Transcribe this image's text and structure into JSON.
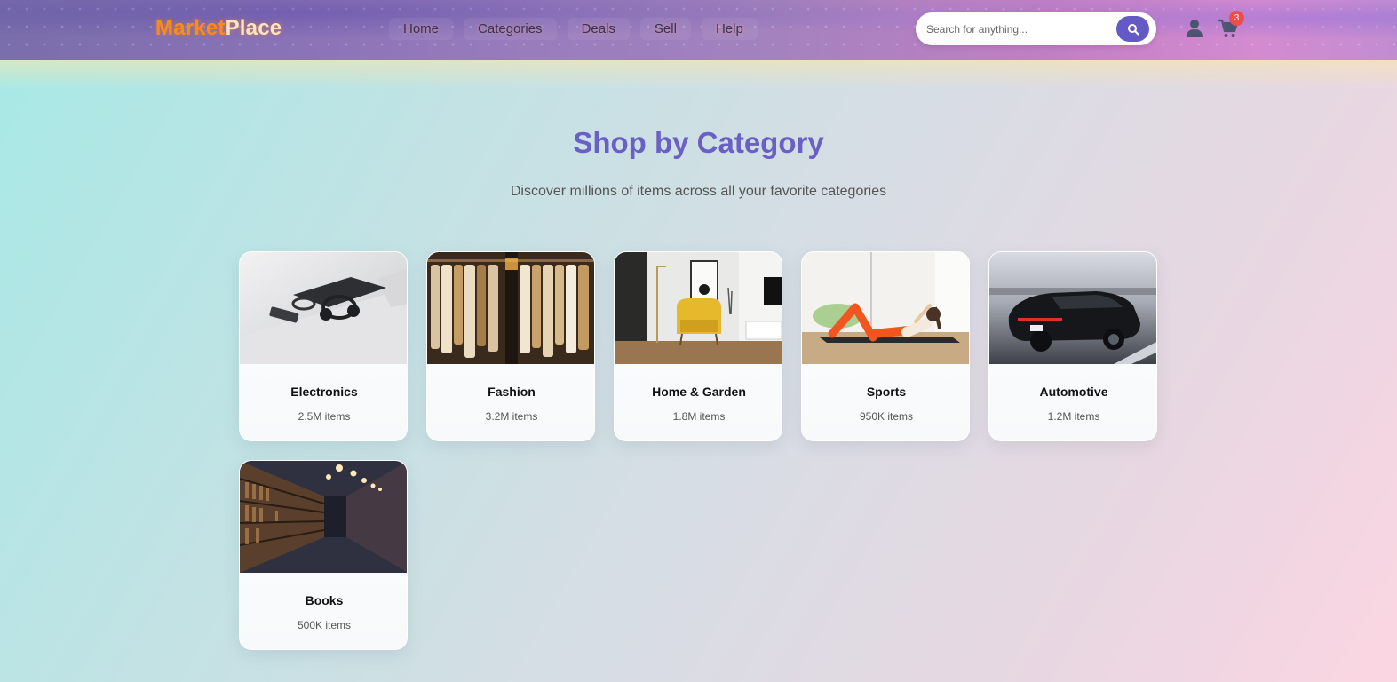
{
  "brand": {
    "part1": "Market",
    "part2": "Place"
  },
  "nav": {
    "items": [
      {
        "label": "Home"
      },
      {
        "label": "Categories"
      },
      {
        "label": "Deals"
      },
      {
        "label": "Sell"
      },
      {
        "label": "Help"
      }
    ]
  },
  "search": {
    "placeholder": "Search for anything...",
    "value": ""
  },
  "header_icons": {
    "user": "user-icon",
    "cart": "cart-icon",
    "search": "search-icon"
  },
  "cart": {
    "count": "3"
  },
  "main": {
    "title": "Shop by Category",
    "subtitle": "Discover millions of items across all your favorite categories",
    "categories": [
      {
        "name": "Electronics",
        "count": "2.5M items"
      },
      {
        "name": "Fashion",
        "count": "3.2M items"
      },
      {
        "name": "Home & Garden",
        "count": "1.8M items"
      },
      {
        "name": "Sports",
        "count": "950K items"
      },
      {
        "name": "Automotive",
        "count": "1.2M items"
      },
      {
        "name": "Books",
        "count": "500K items"
      }
    ]
  },
  "colors": {
    "accent": "#6a5fc4",
    "logo_orange": "#ff8a1a",
    "badge": "#ee4d4d",
    "search_button": "#6559c6"
  }
}
